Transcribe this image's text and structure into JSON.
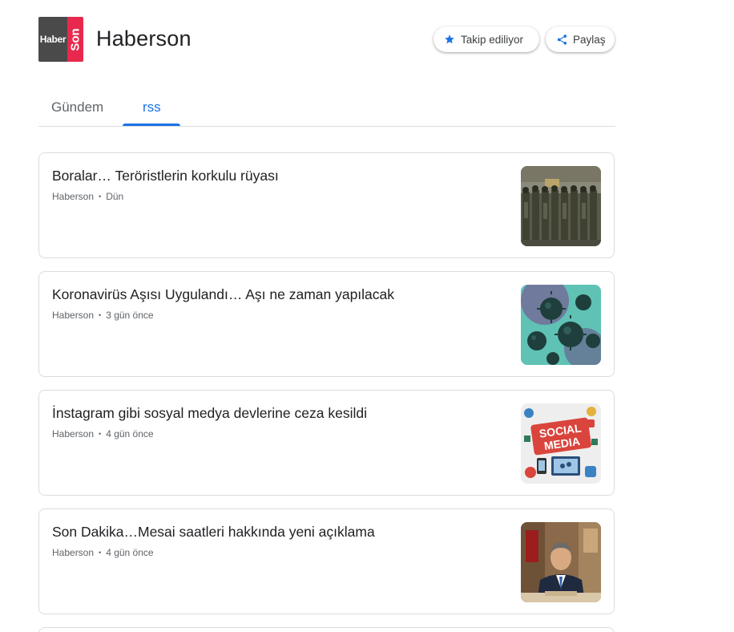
{
  "publication": {
    "name": "Haberson",
    "logo": {
      "left_text": "Haber",
      "right_text": "Son",
      "left_color": "#4a4a4a",
      "right_color": "#e8294d"
    }
  },
  "actions": {
    "follow_label": "Takip ediliyor",
    "follow_icon": "star-icon",
    "share_label": "Paylaş",
    "share_icon": "share-icon"
  },
  "tabs": [
    {
      "label": "Gündem",
      "active": false
    },
    {
      "label": "rss",
      "active": true
    }
  ],
  "accent_color": "#1a73e8",
  "articles": [
    {
      "title": "Boralar… Teröristlerin korkulu rüyası",
      "source": "Haberson",
      "time": "Dün",
      "thumbnail": "soldiers-photo"
    },
    {
      "title": "Koronavirüs Aşısı Uygulandı… Aşı ne zaman yapılacak",
      "source": "Haberson",
      "time": "3 gün önce",
      "thumbnail": "virus-illustration"
    },
    {
      "title": "İnstagram gibi sosyal medya devlerine ceza kesildi",
      "source": "Haberson",
      "time": "4 gün önce",
      "thumbnail": "social-media-illustration",
      "thumb_text": [
        "SOCIAL",
        "MEDIA"
      ]
    },
    {
      "title": "Son Dakika…Mesai saatleri hakkında yeni açıklama",
      "source": "Haberson",
      "time": "4 gün önce",
      "thumbnail": "official-portrait-photo"
    }
  ]
}
